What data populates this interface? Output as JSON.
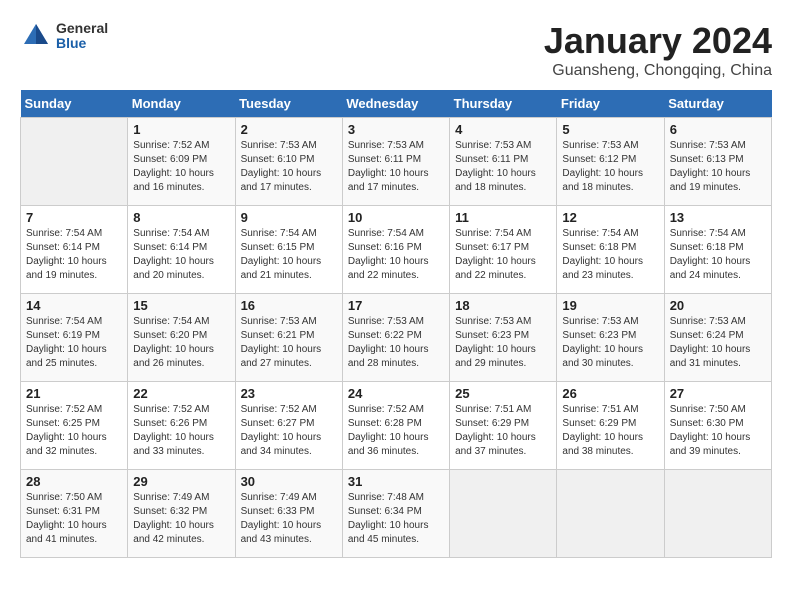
{
  "header": {
    "logo": {
      "general": "General",
      "blue": "Blue"
    },
    "title": "January 2024",
    "location": "Guansheng, Chongqing, China"
  },
  "days_of_week": [
    "Sunday",
    "Monday",
    "Tuesday",
    "Wednesday",
    "Thursday",
    "Friday",
    "Saturday"
  ],
  "weeks": [
    [
      {
        "day": "",
        "info": ""
      },
      {
        "day": "1",
        "info": "Sunrise: 7:52 AM\nSunset: 6:09 PM\nDaylight: 10 hours\nand 16 minutes."
      },
      {
        "day": "2",
        "info": "Sunrise: 7:53 AM\nSunset: 6:10 PM\nDaylight: 10 hours\nand 17 minutes."
      },
      {
        "day": "3",
        "info": "Sunrise: 7:53 AM\nSunset: 6:11 PM\nDaylight: 10 hours\nand 17 minutes."
      },
      {
        "day": "4",
        "info": "Sunrise: 7:53 AM\nSunset: 6:11 PM\nDaylight: 10 hours\nand 18 minutes."
      },
      {
        "day": "5",
        "info": "Sunrise: 7:53 AM\nSunset: 6:12 PM\nDaylight: 10 hours\nand 18 minutes."
      },
      {
        "day": "6",
        "info": "Sunrise: 7:53 AM\nSunset: 6:13 PM\nDaylight: 10 hours\nand 19 minutes."
      }
    ],
    [
      {
        "day": "7",
        "info": "Sunrise: 7:54 AM\nSunset: 6:14 PM\nDaylight: 10 hours\nand 19 minutes."
      },
      {
        "day": "8",
        "info": "Sunrise: 7:54 AM\nSunset: 6:14 PM\nDaylight: 10 hours\nand 20 minutes."
      },
      {
        "day": "9",
        "info": "Sunrise: 7:54 AM\nSunset: 6:15 PM\nDaylight: 10 hours\nand 21 minutes."
      },
      {
        "day": "10",
        "info": "Sunrise: 7:54 AM\nSunset: 6:16 PM\nDaylight: 10 hours\nand 22 minutes."
      },
      {
        "day": "11",
        "info": "Sunrise: 7:54 AM\nSunset: 6:17 PM\nDaylight: 10 hours\nand 22 minutes."
      },
      {
        "day": "12",
        "info": "Sunrise: 7:54 AM\nSunset: 6:18 PM\nDaylight: 10 hours\nand 23 minutes."
      },
      {
        "day": "13",
        "info": "Sunrise: 7:54 AM\nSunset: 6:18 PM\nDaylight: 10 hours\nand 24 minutes."
      }
    ],
    [
      {
        "day": "14",
        "info": "Sunrise: 7:54 AM\nSunset: 6:19 PM\nDaylight: 10 hours\nand 25 minutes."
      },
      {
        "day": "15",
        "info": "Sunrise: 7:54 AM\nSunset: 6:20 PM\nDaylight: 10 hours\nand 26 minutes."
      },
      {
        "day": "16",
        "info": "Sunrise: 7:53 AM\nSunset: 6:21 PM\nDaylight: 10 hours\nand 27 minutes."
      },
      {
        "day": "17",
        "info": "Sunrise: 7:53 AM\nSunset: 6:22 PM\nDaylight: 10 hours\nand 28 minutes."
      },
      {
        "day": "18",
        "info": "Sunrise: 7:53 AM\nSunset: 6:23 PM\nDaylight: 10 hours\nand 29 minutes."
      },
      {
        "day": "19",
        "info": "Sunrise: 7:53 AM\nSunset: 6:23 PM\nDaylight: 10 hours\nand 30 minutes."
      },
      {
        "day": "20",
        "info": "Sunrise: 7:53 AM\nSunset: 6:24 PM\nDaylight: 10 hours\nand 31 minutes."
      }
    ],
    [
      {
        "day": "21",
        "info": "Sunrise: 7:52 AM\nSunset: 6:25 PM\nDaylight: 10 hours\nand 32 minutes."
      },
      {
        "day": "22",
        "info": "Sunrise: 7:52 AM\nSunset: 6:26 PM\nDaylight: 10 hours\nand 33 minutes."
      },
      {
        "day": "23",
        "info": "Sunrise: 7:52 AM\nSunset: 6:27 PM\nDaylight: 10 hours\nand 34 minutes."
      },
      {
        "day": "24",
        "info": "Sunrise: 7:52 AM\nSunset: 6:28 PM\nDaylight: 10 hours\nand 36 minutes."
      },
      {
        "day": "25",
        "info": "Sunrise: 7:51 AM\nSunset: 6:29 PM\nDaylight: 10 hours\nand 37 minutes."
      },
      {
        "day": "26",
        "info": "Sunrise: 7:51 AM\nSunset: 6:29 PM\nDaylight: 10 hours\nand 38 minutes."
      },
      {
        "day": "27",
        "info": "Sunrise: 7:50 AM\nSunset: 6:30 PM\nDaylight: 10 hours\nand 39 minutes."
      }
    ],
    [
      {
        "day": "28",
        "info": "Sunrise: 7:50 AM\nSunset: 6:31 PM\nDaylight: 10 hours\nand 41 minutes."
      },
      {
        "day": "29",
        "info": "Sunrise: 7:49 AM\nSunset: 6:32 PM\nDaylight: 10 hours\nand 42 minutes."
      },
      {
        "day": "30",
        "info": "Sunrise: 7:49 AM\nSunset: 6:33 PM\nDaylight: 10 hours\nand 43 minutes."
      },
      {
        "day": "31",
        "info": "Sunrise: 7:48 AM\nSunset: 6:34 PM\nDaylight: 10 hours\nand 45 minutes."
      },
      {
        "day": "",
        "info": ""
      },
      {
        "day": "",
        "info": ""
      },
      {
        "day": "",
        "info": ""
      }
    ]
  ]
}
